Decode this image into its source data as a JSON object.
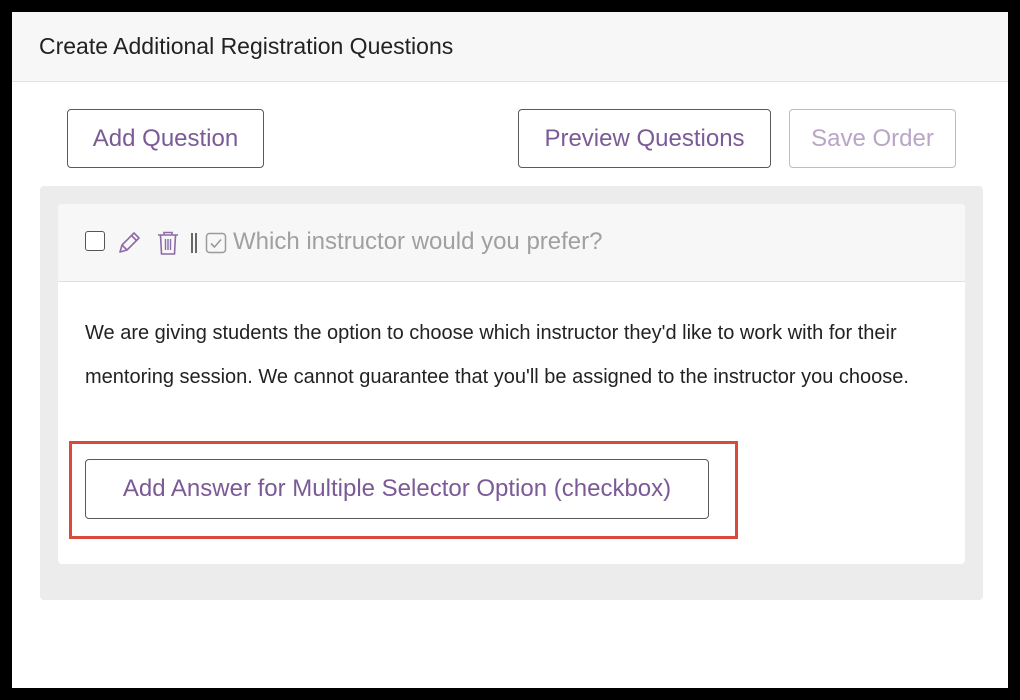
{
  "panel": {
    "title": "Create Additional Registration Questions"
  },
  "toolbar": {
    "add_question_label": "Add Question",
    "preview_questions_label": "Preview Questions",
    "save_order_label": "Save Order",
    "save_order_disabled": true
  },
  "question": {
    "checked": false,
    "title": "Which instructor would you prefer?",
    "type_icon": "checkbox-icon",
    "description": "We are giving students the option to choose which instructor they'd like to work with for their mentoring session. We cannot guarantee that you'll be assigned to the instructor you choose.",
    "add_answer_label": "Add Answer for Multiple Selector Option (checkbox)"
  },
  "colors": {
    "accent": "#7b5a96",
    "accent_disabled": "#b9a5c8",
    "highlight": "#d94a3a",
    "muted_text": "#a0a0a0"
  },
  "icons": [
    "pencil-icon",
    "trash-icon",
    "drag-handle-icon",
    "checkbox-icon"
  ]
}
